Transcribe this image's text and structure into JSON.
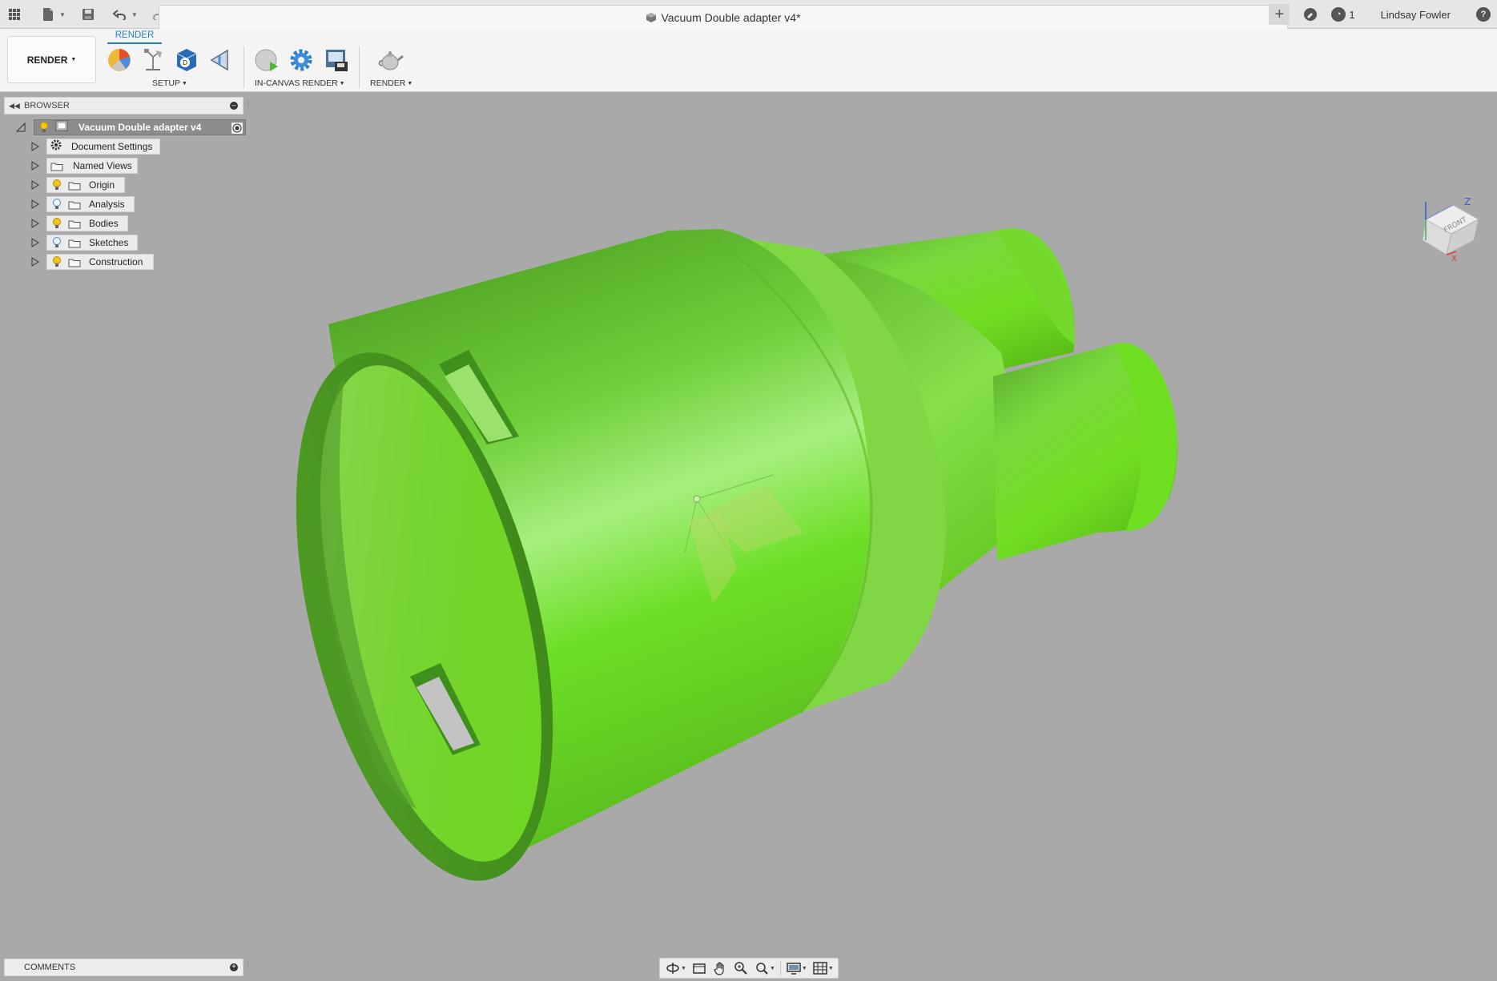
{
  "app": {
    "document_title": "Vacuum Double adapter v4*",
    "user_name": "Lindsay Fowler",
    "notifications_count": "1"
  },
  "toolbar": {
    "workspace_label": "RENDER",
    "active_tab": "RENDER",
    "groups": {
      "setup": "SETUP",
      "in_canvas_render": "IN-CANVAS RENDER",
      "render": "RENDER"
    }
  },
  "browser": {
    "title": "BROWSER",
    "root": "Vacuum Double adapter v4",
    "items": [
      {
        "label": "Document Settings",
        "icon": "gear-icon"
      },
      {
        "label": "Named Views",
        "icon": "folder-icon"
      },
      {
        "label": "Origin",
        "icon": "folder-icon",
        "bulb": "on"
      },
      {
        "label": "Analysis",
        "icon": "folder-icon",
        "bulb": "off"
      },
      {
        "label": "Bodies",
        "icon": "folder-icon",
        "bulb": "on"
      },
      {
        "label": "Sketches",
        "icon": "folder-icon",
        "bulb": "off"
      },
      {
        "label": "Construction",
        "icon": "folder-icon",
        "bulb": "on"
      }
    ]
  },
  "comments": {
    "title": "COMMENTS"
  },
  "colors": {
    "model_green": "#66dd22",
    "accent_blue": "#1c7fc8",
    "viewport_bg": "#a9a9a9"
  }
}
